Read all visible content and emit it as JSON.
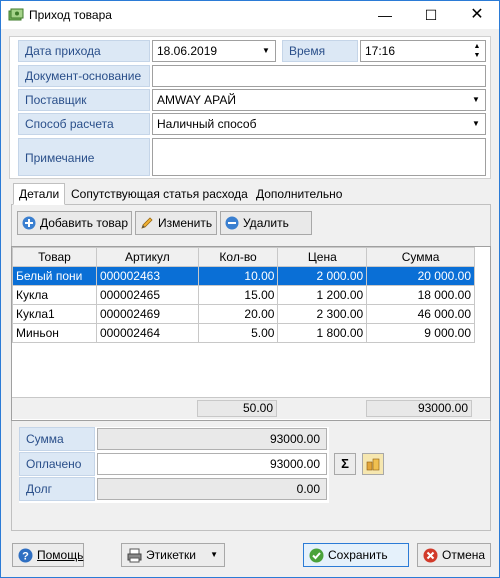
{
  "window": {
    "title": "Приход товара"
  },
  "form": {
    "date_label": "Дата прихода",
    "date_value": "18.06.2019",
    "time_label": "Время",
    "time_value": "17:16",
    "doc_label": "Документ-основание",
    "doc_value": "",
    "supplier_label": "Поставщик",
    "supplier_value": "AMWAY АРАЙ",
    "payment_label": "Способ расчета",
    "payment_value": "Наличный способ",
    "note_label": "Примечание",
    "note_value": ""
  },
  "tabs": [
    "Детали",
    "Сопутствующая статья расхода",
    "Дополнительно"
  ],
  "toolbar": {
    "add_label": "Добавить товар",
    "edit_label": "Изменить",
    "delete_label": "Удалить"
  },
  "table": {
    "headers": [
      "Товар",
      "Артикул",
      "Кол-во",
      "Цена",
      "Сумма"
    ],
    "rows": [
      [
        "Белый пони",
        "000002463",
        "10.00",
        "2 000.00",
        "20 000.00"
      ],
      [
        "Кукла",
        "000002465",
        "15.00",
        "1 200.00",
        "18 000.00"
      ],
      [
        "Кукла1",
        "000002469",
        "20.00",
        "2 300.00",
        "46 000.00"
      ],
      [
        "Миньон",
        "000002464",
        "5.00",
        "1 800.00",
        "9 000.00"
      ]
    ],
    "total_qty": "50.00",
    "total_sum": "93000.00"
  },
  "summary": {
    "sum_label": "Сумма",
    "sum_value": "93000.00",
    "paid_label": "Оплачено",
    "paid_value": "93000.00",
    "debt_label": "Долг",
    "debt_value": "0.00",
    "sigma_label": "Σ"
  },
  "footer": {
    "help_label": "Помощь",
    "labels_label": "Этикетки",
    "save_label": "Сохранить",
    "cancel_label": "Отмена"
  },
  "colors": {
    "accent": "#0a6fd6",
    "label_bg": "#dce8f5",
    "label_text": "#2a4f8a"
  }
}
